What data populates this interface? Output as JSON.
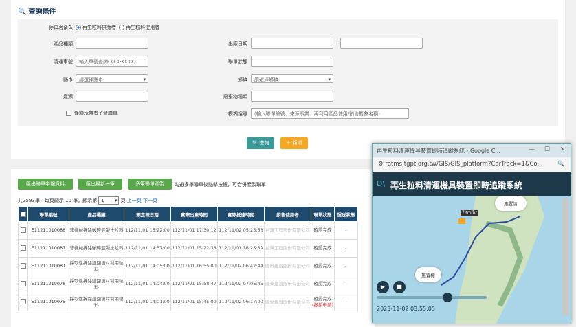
{
  "query": {
    "title": "查詢條件",
    "role_label": "使用者角色",
    "role_opt1": "再生粒料供應者",
    "role_opt2": "再生粒料使用者",
    "product_label": "產品種類",
    "ship_date_label": "出廠日期",
    "date_sep": "~",
    "truck_label": "清運車號",
    "truck_placeholder": "輸入車號查詢(XXX-XXXX)",
    "form_status_label": "聯單狀態",
    "city_label": "縣市",
    "city_value": "請選擇縣市",
    "town_label": "鄉鎮",
    "town_value": "請選擇鄉鎮",
    "source_label": "產源",
    "waste_label": "廢棄物種類",
    "only_sub_label": "僅顯示擁有子清聯單",
    "keyword_label": "模糊搜尋",
    "keyword_placeholder": "(輸入聯單編號、來源事業、再利用產品使用/銷售對象名稱)",
    "search_btn": "查詢",
    "add_btn": "新增"
  },
  "toolbar": {
    "export_btn": "匯出聯單申報資料",
    "export_latest_btn": "匯出最新一筆",
    "multi_print_btn": "多筆聯單產製",
    "multi_hint": "勾選多筆聯單後點擊按鈕，可合併產製聯單",
    "paging_prefix": "共2593筆，每頁顯示 10 筆，顯示第",
    "page_value": "1",
    "paging_suffix": "頁",
    "prev": "上一頁",
    "next": "下一頁"
  },
  "table": {
    "headers": [
      "聯單編號",
      "產品種類",
      "預定報日期",
      "實際出廠時間",
      "實際抵達時間",
      "銷售使用者",
      "聯單狀態",
      "運送狀態"
    ],
    "rows": [
      {
        "id": "E11211010088",
        "product": "非機械拆除破碎混凝土粒料",
        "plan": "112/11/01 15:22:00",
        "out": "112/11/01 17:30:12",
        "arrive": "112/11/02 05:25:58",
        "user": "台灣工程股份有限公司",
        "status": "確認完成",
        "trans": "-"
      },
      {
        "id": "E11211010087",
        "product": "非機械拆除破碎混凝土粒料",
        "plan": "112/11/01 14:37:00",
        "out": "112/11/01 15:22:38",
        "arrive": "112/11/01 16:25:39",
        "user": "台灣工程股份有限公司",
        "status": "確認完成",
        "trans": "-"
      },
      {
        "id": "E11211010081",
        "product": "採取性拆除建回填材利用粒料",
        "plan": "112/11/01 14:05:00",
        "out": "112/11/01 16:55:00",
        "arrive": "112/11/02 06:42:44",
        "user": "國泰建設股份有限公司",
        "status": "確認完成",
        "trans": "-"
      },
      {
        "id": "E11211010078",
        "product": "採取性拆除建回填材利用粒料",
        "plan": "112/11/01 14:04:00",
        "out": "112/11/01 15:58:47",
        "arrive": "112/11/02 07:06:45",
        "user": "國泰建設股份有限公司",
        "status": "確認完成",
        "trans": "-"
      },
      {
        "id": "E11211010075",
        "product": "採取性拆除建回填材利用粒料",
        "plan": "112/11/01 14:01:00",
        "out": "112/11/01 15:45:00",
        "arrive": "112/11/02 06:17:00",
        "user": "國泰建設股份有限公司",
        "status": "確認完成",
        "status2": "(撤銷申請)",
        "trans": "-"
      }
    ]
  },
  "popup": {
    "window_title": "再生粒料清運機具裝置即時追蹤系統 - Google C...",
    "url": "ratms.tgpt.org.tw/GIS/GIS_platform?CarTrack=1&Co...",
    "header_title": "再生粒料清運機具裝置即時追蹤系統",
    "bubble1": "應置清",
    "bubble2": "施置標",
    "truck_label": "7Km/hr",
    "timestamp": "2023-11-02 03:55:05"
  },
  "colors": {
    "primary": "#1e4a6e",
    "green": "#5aa84c",
    "teal": "#3a9a9a",
    "orange": "#f5a623"
  }
}
